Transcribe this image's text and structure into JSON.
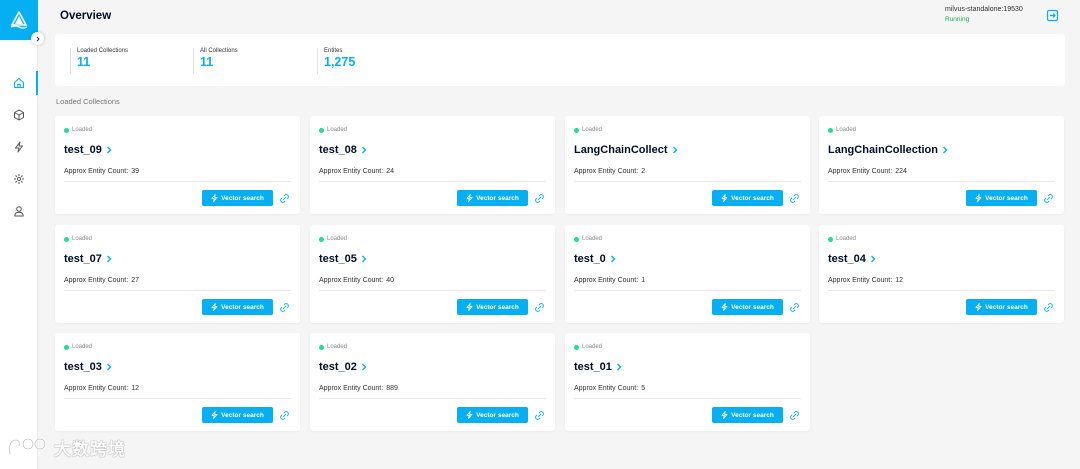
{
  "header": {
    "title": "Overview",
    "connection": {
      "address": "milvus-standalone:19530",
      "status": "Running"
    }
  },
  "stats": [
    {
      "label": "Loaded Collections",
      "value": "11"
    },
    {
      "label": "All Collections",
      "value": "11"
    },
    {
      "label": "Entites",
      "value": "1,275"
    }
  ],
  "section_title": "Loaded Collections",
  "cards": [
    {
      "status": "Loaded",
      "name": "test_09",
      "count_label": "Approx Entity Count:",
      "count": "39",
      "button": "Vector search"
    },
    {
      "status": "Loaded",
      "name": "test_08",
      "count_label": "Approx Entity Count:",
      "count": "24",
      "button": "Vector search"
    },
    {
      "status": "Loaded",
      "name": "LangChainCollect",
      "count_label": "Approx Entity Count:",
      "count": "2",
      "button": "Vector search"
    },
    {
      "status": "Loaded",
      "name": "LangChainCollection",
      "count_label": "Approx Entity Count:",
      "count": "224",
      "button": "Vector search"
    },
    {
      "status": "Loaded",
      "name": "test_07",
      "count_label": "Approx Entity Count:",
      "count": "27",
      "button": "Vector search"
    },
    {
      "status": "Loaded",
      "name": "test_05",
      "count_label": "Approx Entity Count:",
      "count": "40",
      "button": "Vector search"
    },
    {
      "status": "Loaded",
      "name": "test_0",
      "count_label": "Approx Entity Count:",
      "count": "1",
      "button": "Vector search"
    },
    {
      "status": "Loaded",
      "name": "test_04",
      "count_label": "Approx Entity Count:",
      "count": "12",
      "button": "Vector search"
    },
    {
      "status": "Loaded",
      "name": "test_03",
      "count_label": "Approx Entity Count:",
      "count": "12",
      "button": "Vector search"
    },
    {
      "status": "Loaded",
      "name": "test_02",
      "count_label": "Approx Entity Count:",
      "count": "889",
      "button": "Vector search"
    },
    {
      "status": "Loaded",
      "name": "test_01",
      "count_label": "Approx Entity Count:",
      "count": "5",
      "button": "Vector search"
    }
  ],
  "sidebar": {
    "items": [
      {
        "icon": "home-icon",
        "active": true
      },
      {
        "icon": "cube-icon",
        "active": false
      },
      {
        "icon": "lightning-icon",
        "active": false
      },
      {
        "icon": "sparkle-icon",
        "active": false
      },
      {
        "icon": "user-icon",
        "active": false
      }
    ]
  },
  "watermark": {
    "text": "大数跨境"
  },
  "colors": {
    "accent": "#06aff2",
    "loaded": "#1ddd9a",
    "running": "#1ba954",
    "background": "#f5f5f5"
  }
}
